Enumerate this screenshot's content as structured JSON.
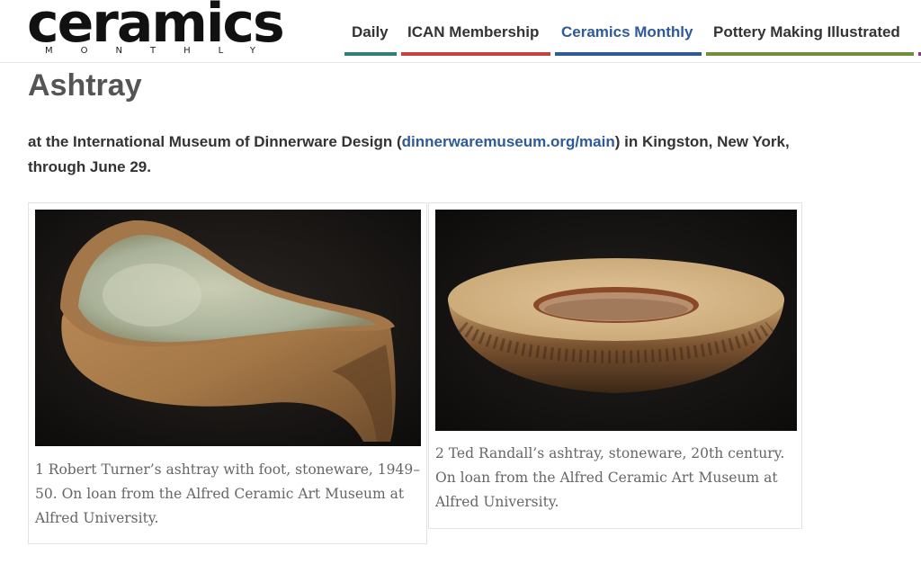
{
  "logo": {
    "word": "ceramics",
    "sub": "MONTHLY"
  },
  "nav": {
    "items": [
      {
        "label": "Daily",
        "color": "#2f7f7a"
      },
      {
        "label": "ICAN Membership",
        "color": "#c8413a"
      },
      {
        "label": "Ceramics Monthly",
        "color": "#2e5a97"
      },
      {
        "label": "Pottery Making Illustrated",
        "color": "#6f8f3a"
      }
    ],
    "active_index": 2
  },
  "page": {
    "title": "Ashtray",
    "intro_before": "at the International Museum of Dinnerware Design (",
    "intro_link": "dinnerwaremuseum.org/main",
    "intro_after": ") in Kingston, New York, through June 29."
  },
  "figures": [
    {
      "caption": "1 Robert Turner’s ashtray with foot, stoneware, 1949–50. On loan from the Alfred Ceramic Art Museum at Alfred University."
    },
    {
      "caption": "2 Ted Randall’s ashtray, stoneware, 20th century. On loan from the Alfred Ceramic Art Museum at Alfred University."
    }
  ],
  "colors": {
    "accent": "#2e5a97",
    "title": "#555555"
  }
}
